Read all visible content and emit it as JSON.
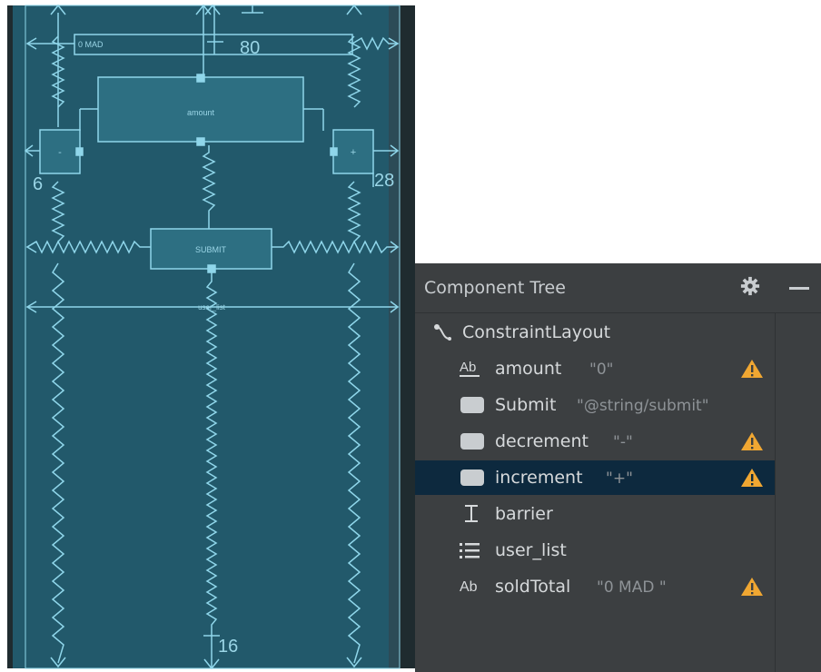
{
  "blueprint": {
    "sold_total_label": "0 MAD",
    "amount_label": "amount",
    "decrement_label": "-",
    "increment_label": "+",
    "submit_label": "SUBMIT",
    "user_list_label": "user_list",
    "margin_80": "80",
    "margin_6": "6",
    "margin_28": "28",
    "margin_16": "16"
  },
  "tree": {
    "title": "Component Tree",
    "icons": {
      "settings": "gear-icon",
      "hide": "minimize-icon",
      "warning": "warning-icon"
    },
    "items": [
      {
        "name": "ConstraintLayout",
        "value": "",
        "icon": "constraint-layout-icon",
        "warning": false
      },
      {
        "name": "amount",
        "value": "\"0\"",
        "icon": "text-view-icon",
        "warning": true
      },
      {
        "name": "Submit",
        "value": "\"@string/submit\"",
        "icon": "button-icon",
        "warning": false
      },
      {
        "name": "decrement",
        "value": "\"-\"",
        "icon": "button-icon",
        "warning": true
      },
      {
        "name": "increment",
        "value": "\"+\"",
        "icon": "button-icon",
        "warning": true,
        "selected": true
      },
      {
        "name": "barrier",
        "value": "",
        "icon": "barrier-icon",
        "warning": false
      },
      {
        "name": "user_list",
        "value": "",
        "icon": "recycler-view-icon",
        "warning": false
      },
      {
        "name": "soldTotal",
        "value": "\"0 MAD \"",
        "icon": "text-view-icon",
        "warning": true
      }
    ],
    "colors": {
      "panel": "#3c3f41",
      "selection": "#0d293e",
      "warning": "#f0a732",
      "blueprint": "#22596b"
    }
  }
}
